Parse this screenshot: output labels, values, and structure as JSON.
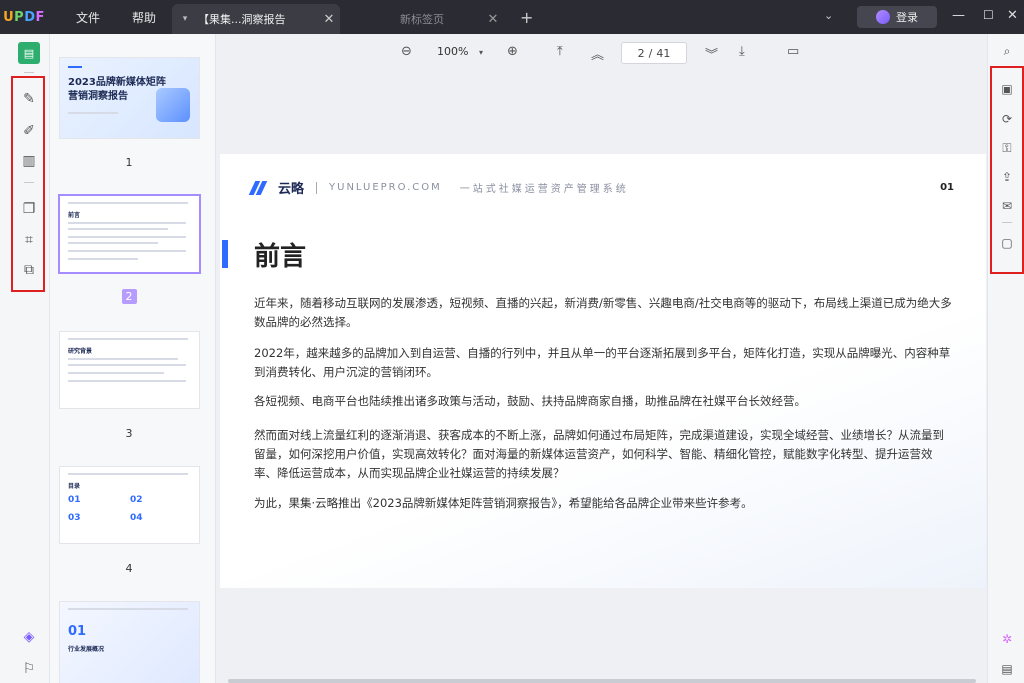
{
  "app": {
    "logo": "UPDF"
  },
  "menu": {
    "file": "文件",
    "help": "帮助"
  },
  "tabs": [
    {
      "title": "【果集...洞察报告",
      "active": true
    },
    {
      "title": "新标签页",
      "active": false
    }
  ],
  "header": {
    "login": "登录"
  },
  "toolbar": {
    "zoom": "100%",
    "current_page": "2",
    "total_pages": "41",
    "page_sep": "/"
  },
  "thumbnails": [
    {
      "num": "1",
      "title": "2023品牌新媒体矩阵\n营销洞察报告"
    },
    {
      "num": "2",
      "heading": "前言"
    },
    {
      "num": "3",
      "heading": "研究背景"
    },
    {
      "num": "4",
      "heading": "目录",
      "items": [
        "01",
        "02",
        "03",
        "04"
      ]
    },
    {
      "num": "5",
      "big": "01",
      "heading": "行业发展概况"
    }
  ],
  "page": {
    "brand_name": "云略",
    "brand_url": "YUNLUEPRO.COM",
    "brand_slogan": "一站式社媒运营资产管理系统",
    "page_no": "01",
    "heading": "前言",
    "paragraphs": [
      "近年来，随着移动互联网的发展渗透，短视频、直播的兴起，新消费/新零售、兴趣电商/社交电商等的驱动下，布局线上渠道已成为绝大多数品牌的必然选择。",
      "2022年，越来越多的品牌加入到自运营、自播的行列中，并且从单一的平台逐渐拓展到多平台，矩阵化打造，实现从品牌曝光、内容种草到消费转化、用户沉淀的营销闭环。",
      "各短视频、电商平台也陆续推出诸多政策与活动，鼓励、扶持品牌商家自播，助推品牌在社媒平台长效经营。",
      "然而面对线上流量红利的逐渐消退、获客成本的不断上涨，品牌如何通过布局矩阵，完成渠道建设，实现全域经营、业绩增长？从流量到留量，如何深挖用户价值，实现高效转化？面对海量的新媒体运营资产，如何科学、智能、精细化管控，赋能数字化转型、提升运营效率、降低运营成本，从而实现品牌企业社媒运营的持续发展？",
      "为此，果集·云略推出《2023品牌新媒体矩阵营销洞察报告》，希望能给各品牌企业带来些许参考。"
    ]
  },
  "colors": {
    "accent": "#2f6bff",
    "highlight": "#e02020",
    "selection": "#b79cff"
  }
}
